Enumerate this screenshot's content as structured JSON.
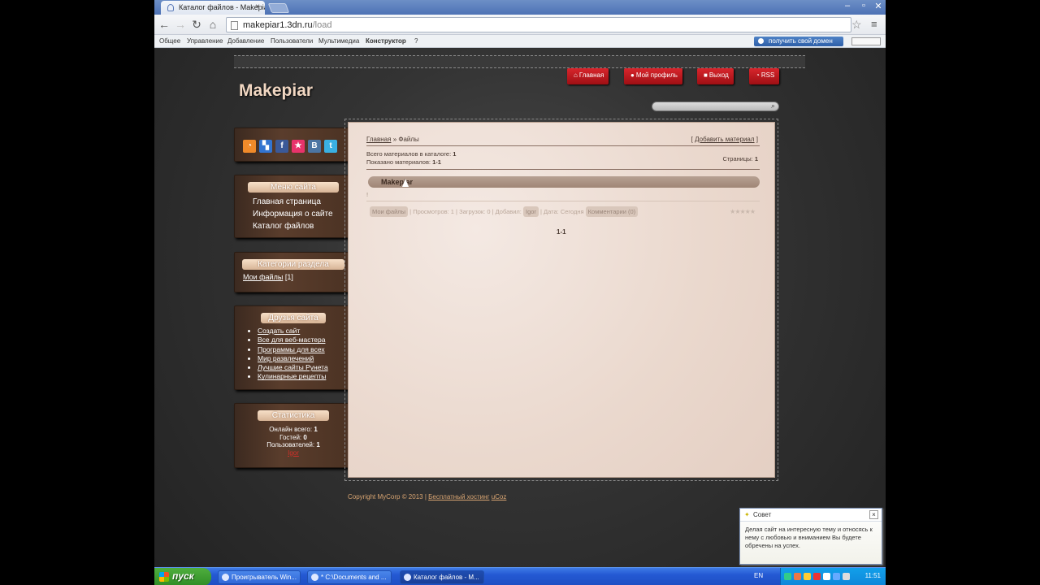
{
  "browser": {
    "tab_title": "Каталог файлов - Makepiar",
    "url_host": "makepiar1.3dn.ru",
    "url_path": "/load"
  },
  "ucoz_bar": {
    "items": [
      "Общее",
      "Управление",
      "Добавление",
      "Пользователи",
      "Мультимедиа",
      "Конструктор",
      "?"
    ],
    "domain_button": "получить свой домен"
  },
  "site": {
    "logo": "Makepiar",
    "top_nav": [
      "Главная",
      "Мой профиль",
      "Выход",
      "RSS"
    ]
  },
  "sidebar": {
    "social_icons": [
      "rss-icon",
      "delicious-icon",
      "facebook-icon",
      "bookmark-icon",
      "vk-icon",
      "twitter-icon"
    ],
    "menu_title": "Меню сайта",
    "menu_items": [
      "Главная страница",
      "Информация о сайте",
      "Каталог файлов"
    ],
    "categories_title": "Категории раздела",
    "category_link": "Мои файлы",
    "category_count": "[1]",
    "friends_title": "Друзья сайта",
    "friends": [
      "Создать сайт",
      "Все для веб-мастера",
      "Программы для всех",
      "Мир развлечений",
      "Лучшие сайты Рунета",
      "Кулинарные рецепты"
    ],
    "stats_title": "Статистика",
    "stats": {
      "online_label": "Онлайн всего:",
      "online": "1",
      "guests_label": "Гостей:",
      "guests": "0",
      "users_label": "Пользователей:",
      "users": "1",
      "user_name": "Igor"
    }
  },
  "content": {
    "breadcrumb_home": "Главная",
    "breadcrumb_sep": "»",
    "breadcrumb_current": "Файлы",
    "add_material": "Добавить материал",
    "total_label": "Всего материалов в каталоге:",
    "total": "1",
    "shown_label": "Показано материалов:",
    "shown": "1-1",
    "pages_label": "Страницы:",
    "pages": "1",
    "entry_title": "Makepiar",
    "entry_text": "!",
    "meta": {
      "category": "Мои файлы",
      "views": "| Просмотров: 1",
      "downloads": "| Загрузок: 0",
      "added_by_label": "| Добавил:",
      "author": "Igor",
      "date": "| Дата: Сегодня",
      "comments": "Комментарии (0)"
    },
    "pagination": "1-1"
  },
  "footer": {
    "copyright": "Copyright MyCorp © 2013",
    "hosting": "Бесплатный хостинг",
    "ucoz": "uCoz"
  },
  "hint": {
    "title": "Совет",
    "text": "Делая сайт на интересную тему и относясь к нему с любовью и вниманием Вы будете обречены на успех."
  },
  "taskbar": {
    "start": "пуск",
    "tasks": [
      "Проигрыватель Win...",
      "* C:\\Documents and ...",
      "Каталог файлов - M..."
    ],
    "lang": "EN",
    "clock": "11:51"
  }
}
